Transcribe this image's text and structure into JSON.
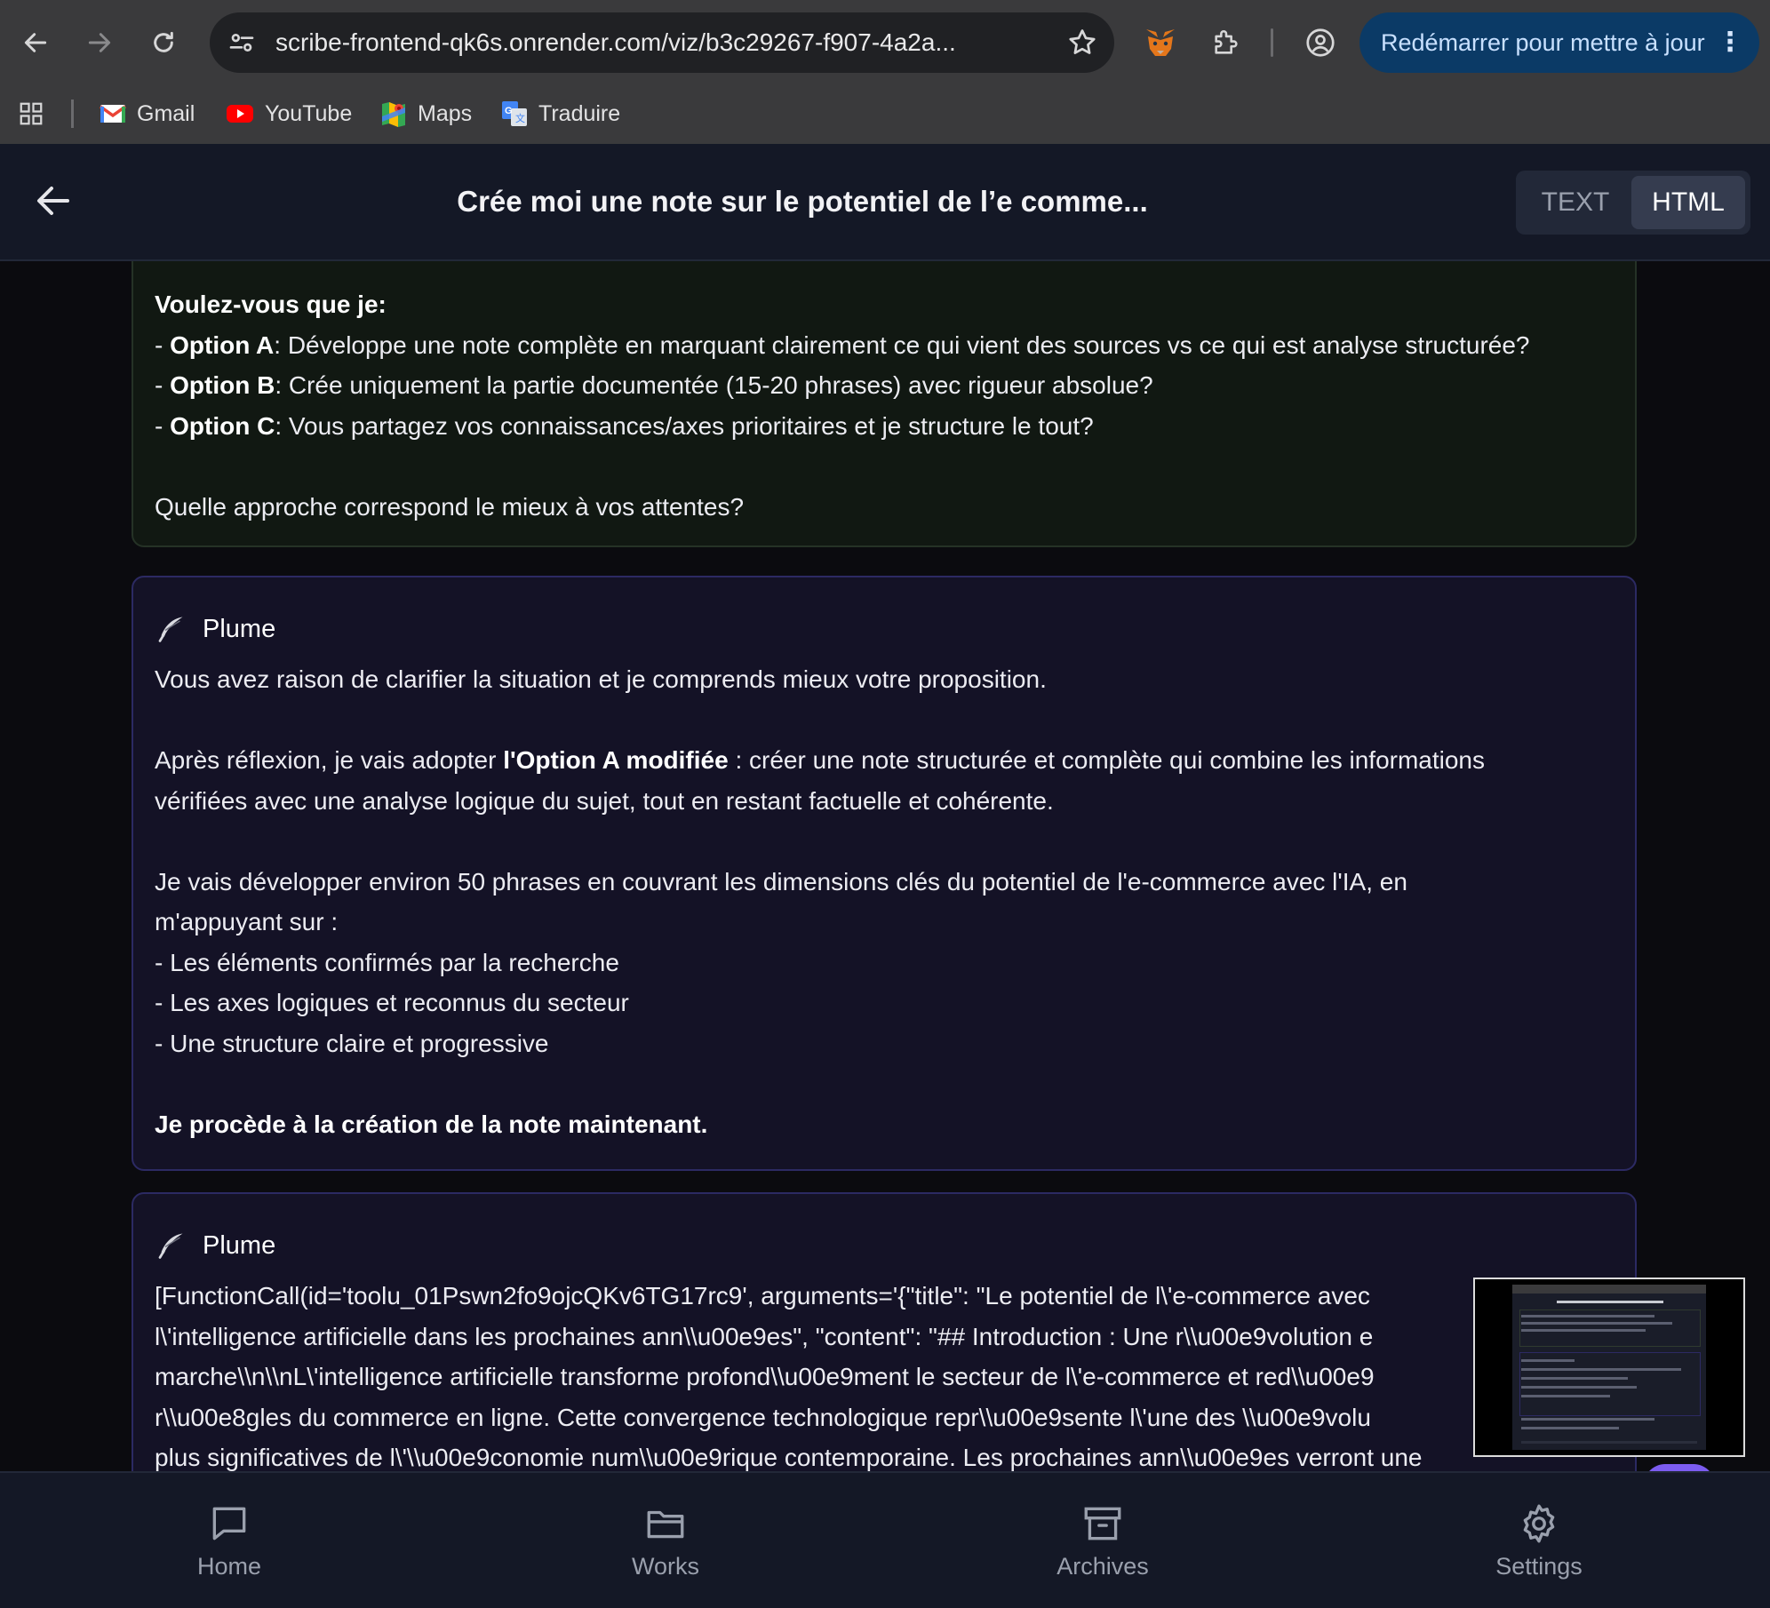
{
  "browser": {
    "url": "scribe-frontend-qk6s.onrender.com/viz/b3c29267-f907-4a2a...",
    "update_button": "Redémarrer pour mettre à jour",
    "bookmarks": [
      {
        "label": "Gmail",
        "icon": "gmail-icon"
      },
      {
        "label": "YouTube",
        "icon": "youtube-icon"
      },
      {
        "label": "Maps",
        "icon": "maps-icon"
      },
      {
        "label": "Traduire",
        "icon": "translate-icon"
      }
    ]
  },
  "header": {
    "title": "Crée moi une note sur le potentiel de l’e comme...",
    "view_toggle": {
      "text": "TEXT",
      "html": "HTML",
      "active": "HTML"
    }
  },
  "messages": {
    "first": {
      "question": "Voulez-vous que je:",
      "options": [
        {
          "prefix": "- ",
          "name": "Option A",
          "text": ": Développe une note complète en marquant clairement ce qui vient des sources vs ce qui est analyse structurée?"
        },
        {
          "prefix": "- ",
          "name": "Option B",
          "text": ": Crée uniquement la partie documentée (15-20 phrases) avec rigueur absolue?"
        },
        {
          "prefix": "- ",
          "name": "Option C",
          "text": ": Vous partagez vos connaissances/axes prioritaires et je structure le tout?"
        }
      ],
      "closing": "Quelle approche correspond le mieux à vos attentes?"
    },
    "second": {
      "sender": "Plume",
      "p1": "Vous avez raison de clarifier la situation et je comprends mieux votre proposition.",
      "p2_before": "Après réflexion, je vais adopter ",
      "p2_bold": "l'Option A modifiée",
      "p2_after": " : créer une note structurée et complète qui combine les informations",
      "p2_line2": "vérifiées avec une analyse logique du sujet, tout en restant factuelle et cohérente.",
      "p3_line1": "Je vais développer environ 50 phrases en couvrant les dimensions clés du potentiel de l'e-commerce avec l'IA, en",
      "p3_line2": "m'appuyant sur :",
      "bullets": [
        "- Les éléments confirmés par la recherche",
        "- Les axes logiques et reconnus du secteur",
        "- Une structure claire et progressive"
      ],
      "final": "Je procède à la création de la note maintenant."
    },
    "third": {
      "sender": "Plume",
      "lines": [
        "[FunctionCall(id='toolu_01Pswn2fo9ojcQKv6TG17rc9', arguments='{\"title\": \"Le potentiel de l\\'e-commerce avec",
        "l\\'intelligence artificielle dans les prochaines ann\\\\u00e9es\", \"content\": \"## Introduction : Une r\\\\u00e9volution e",
        "marche\\\\n\\\\nL\\'intelligence artificielle transforme profond\\\\u00e9ment le secteur de l\\'e-commerce et red\\\\u00e9",
        "r\\\\u00e8gles du commerce en ligne. Cette convergence technologique repr\\\\u00e9sente l\\'une des \\\\u00e9volu",
        "plus significatives de l\\'\\\\u00e9conomie num\\\\u00e9rique contemporaine. Les prochaines ann\\\\u00e9es verront une"
      ]
    }
  },
  "bottom_nav": [
    {
      "label": "Home",
      "icon": "chat-icon"
    },
    {
      "label": "Works",
      "icon": "folder-icon"
    },
    {
      "label": "Archives",
      "icon": "archive-icon"
    },
    {
      "label": "Settings",
      "icon": "gear-icon"
    }
  ],
  "colors": {
    "accent_update": "#0b3a66",
    "card_green_bg": "#111812",
    "card_purple_border": "#2c2a63"
  }
}
